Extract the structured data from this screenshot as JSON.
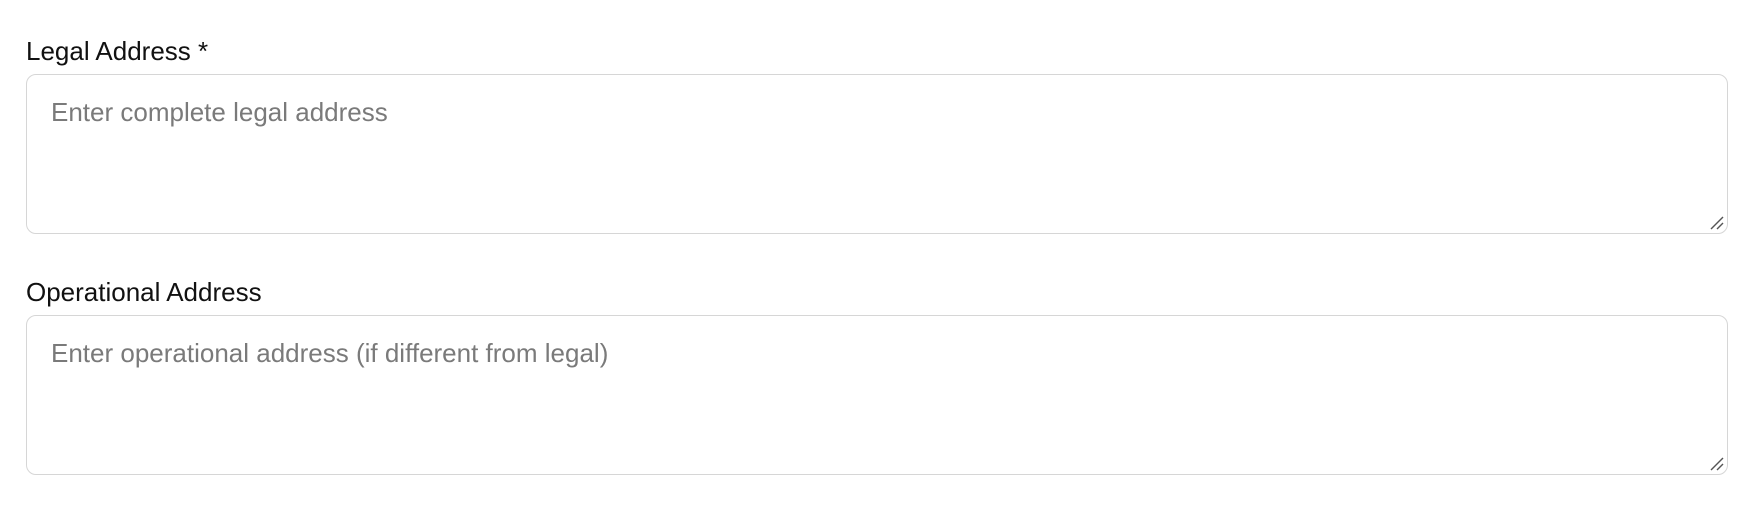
{
  "form": {
    "legal_address": {
      "label": "Legal Address *",
      "value": "",
      "placeholder": "Enter complete legal address"
    },
    "operational_address": {
      "label": "Operational Address",
      "value": "",
      "placeholder": "Enter operational address (if different from legal)"
    }
  },
  "icons": {
    "resize_grip": "resize-grip-icon"
  },
  "colors": {
    "border": "#d6d6d6",
    "placeholder": "#7a7a7a",
    "label": "#111111"
  }
}
